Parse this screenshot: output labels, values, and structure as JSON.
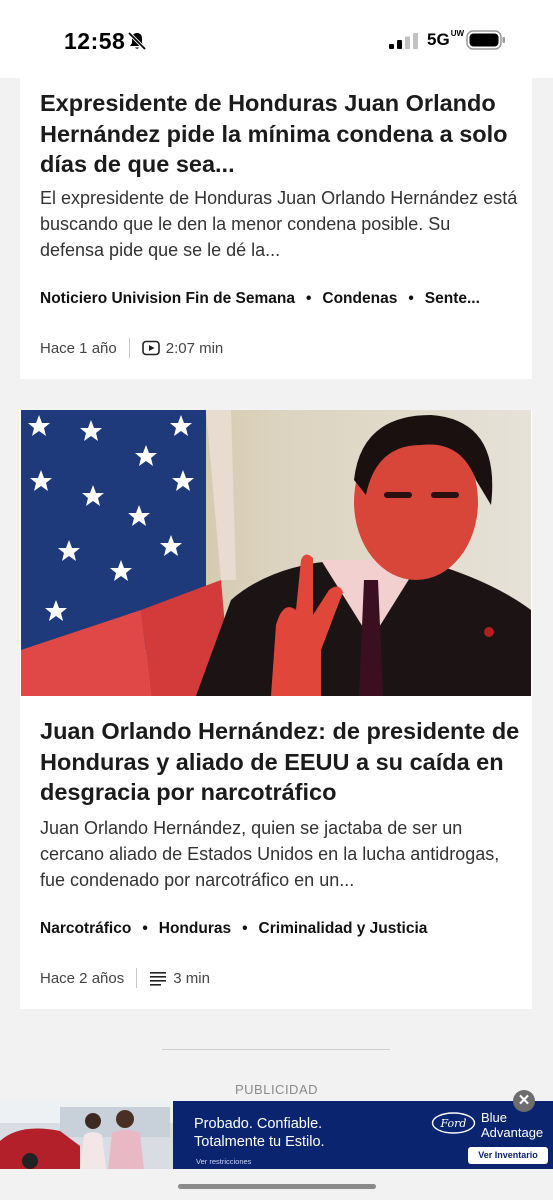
{
  "status_bar": {
    "time": "12:58",
    "network": "5G",
    "network_suffix": "UW"
  },
  "articles": [
    {
      "headline": "Expresidente de Honduras Juan Orlando Hernández pide la mínima condena a solo días de que sea...",
      "summary": "El expresidente de Honduras Juan Orlando Hernández está buscando que le den la menor condena posible. Su defensa pide que se le dé la...",
      "tags": [
        "Noticiero Univision Fin de Semana",
        "Condenas",
        "Sente..."
      ],
      "age": "Hace 1 año",
      "media_icon": "video-play-icon",
      "duration": "2:07 min"
    },
    {
      "image": "portrait-in-front-of-us-flag",
      "headline": "Juan Orlando Hernández: de presidente de Honduras y aliado de EEUU a su caída en desgracia por narcotráfico",
      "summary": "Juan Orlando Hernández, quien se jactaba de ser un cercano aliado de Estados Unidos en la lucha antidrogas, fue condenado por narcotráfico en un...",
      "tags": [
        "Narcotráfico",
        "Honduras",
        "Criminalidad y Justicia"
      ],
      "age": "Hace 2 años",
      "media_icon": "text-lines-icon",
      "duration": "3 min"
    }
  ],
  "ad_section": {
    "label": "PUBLICIDAD",
    "headline_line1": "Probado. Confiable.",
    "headline_line2": "Totalmente tu Estilo.",
    "fine_print": "Ver restricciones",
    "brand_logo": "Ford",
    "brand_line1": "Blue",
    "brand_line2": "Advantage",
    "cta": "Ver Inventario",
    "close": "✕"
  },
  "colors": {
    "background": "#f2f2f2",
    "card": "#ffffff",
    "ad_blue": "#0a2470"
  }
}
